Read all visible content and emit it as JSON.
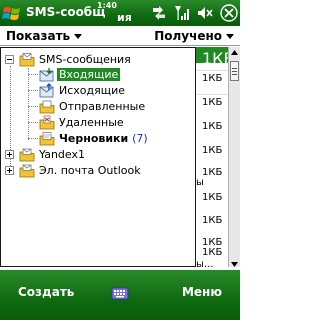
{
  "titlebar": {
    "title": "SMS-сообщ",
    "clock": "1:40",
    "clock_suffix": "ия",
    "icons": [
      "windows-start-icon",
      "sync-icon",
      "signal-icon",
      "speaker-icon",
      "ok-icon"
    ]
  },
  "header": {
    "show_label": "Показать",
    "sort_label": "Получено"
  },
  "tree": {
    "root": {
      "label": "SMS-сообщения",
      "icon": "messages-folder-icon"
    },
    "folders": [
      {
        "label": "Входящие",
        "icon": "inbox-icon",
        "selected": true
      },
      {
        "label": "Исходящие",
        "icon": "outbox-icon"
      },
      {
        "label": "Отправленные",
        "icon": "sent-icon"
      },
      {
        "label": "Удаленные",
        "icon": "deleted-icon"
      },
      {
        "label": "Черновики",
        "count": "(7)",
        "icon": "drafts-icon",
        "bold": true
      }
    ],
    "accounts": [
      {
        "label": "Yandex1",
        "icon": "account-icon"
      },
      {
        "label": "Эл. почта Outlook",
        "icon": "account-icon"
      }
    ]
  },
  "messages": {
    "sizes": [
      "1КБ",
      "1КБ",
      "1КБ",
      "1КБ",
      "1КБ",
      "1КБ",
      "1КБ",
      "1КБ",
      "1КБ",
      "1КБ",
      "1КБ"
    ],
    "fragments": [
      "ы",
      "ы..."
    ]
  },
  "softkeys": {
    "left": "Создать",
    "right": "Меню"
  },
  "colors": {
    "accent": "#1f8a22",
    "bar": "#0f6a10",
    "count": "#1a36b8"
  }
}
